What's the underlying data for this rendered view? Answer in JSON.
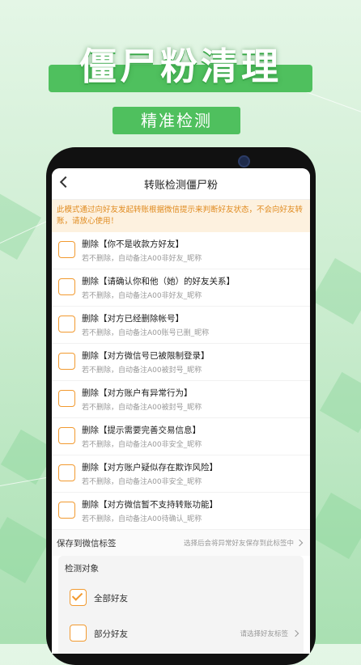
{
  "hero": {
    "title": "僵尸粉清理",
    "subtitle": "精准检测"
  },
  "app": {
    "nav_title": "转账检测僵尸粉",
    "notice": "此模式通过向好友发起转账根据微信提示来判断好友状态，不会向好友转账，请放心使用！",
    "rules": [
      {
        "title": "删除【你不是收款方好友】",
        "desc": "若不删除，自动备注A00非好友_昵称"
      },
      {
        "title": "删除【请确认你和他（她）的好友关系】",
        "desc": "若不删除，自动备注A00非好友_昵称"
      },
      {
        "title": "删除【对方已经删除帐号】",
        "desc": "若不删除，自动备注A00账号已删_昵称"
      },
      {
        "title": "删除【对方微信号已被限制登录】",
        "desc": "若不删除，自动备注A00被封号_昵称"
      },
      {
        "title": "删除【对方账户有异常行为】",
        "desc": "若不删除，自动备注A00被封号_昵称"
      },
      {
        "title": "删除【提示需要完善交易信息】",
        "desc": "若不删除，自动备注A00非安全_昵称"
      },
      {
        "title": "删除【对方账户疑似存在欺诈风险】",
        "desc": "若不删除，自动备注A00非安全_昵称"
      },
      {
        "title": "删除【对方微信暂不支持转账功能】",
        "desc": "若不删除，自动备注A00待确认_昵称"
      }
    ],
    "save": {
      "label": "保存到微信标签",
      "hint": "选择后会将异常好友保存到此标签中"
    },
    "target": {
      "title": "检测对象",
      "all_label": "全部好友",
      "all_checked": true,
      "part_label": "部分好友",
      "part_hint": "请选择好友标签"
    }
  },
  "colors": {
    "accent": "#f29a30",
    "brand_green": "#4fc05e",
    "notice_bg": "#fdf1df",
    "notice_text": "#e08a1e"
  }
}
